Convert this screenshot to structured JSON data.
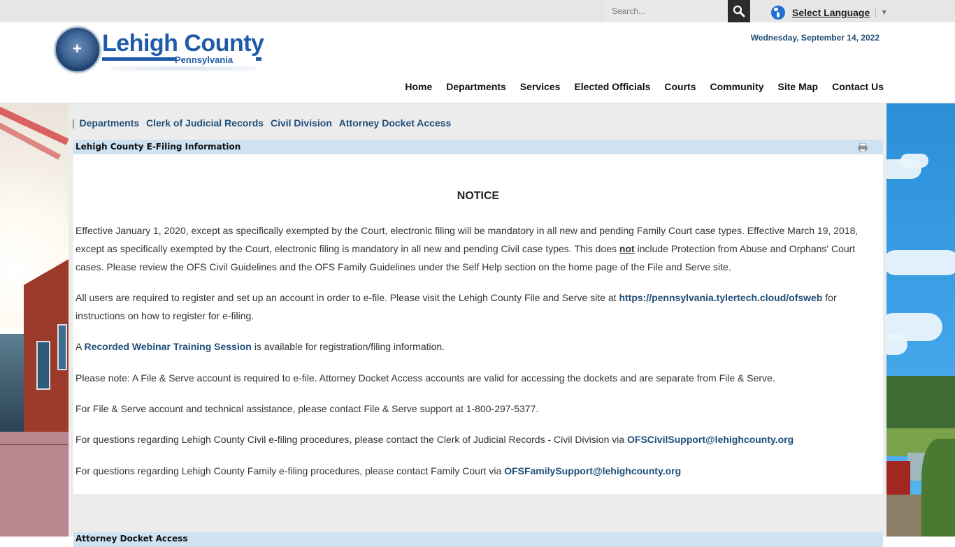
{
  "topbar": {
    "search_placeholder": "Search...",
    "search_button_icon": "search-icon",
    "language_icon": "globe-icon",
    "language_label": "Select Language",
    "language_arrow": "▼"
  },
  "header": {
    "logo_title": "Lehigh County",
    "logo_subtitle": "Pennsylvania",
    "date": "Wednesday, September 14, 2022",
    "nav": [
      {
        "label": "Home"
      },
      {
        "label": "Departments"
      },
      {
        "label": "Services"
      },
      {
        "label": "Elected Officials"
      },
      {
        "label": "Courts"
      },
      {
        "label": "Community"
      },
      {
        "label": "Site Map"
      },
      {
        "label": "Contact Us"
      }
    ]
  },
  "breadcrumb": {
    "separator": "|",
    "items": [
      {
        "label": "Departments"
      },
      {
        "label": "Clerk of Judicial Records"
      },
      {
        "label": "Civil Division"
      },
      {
        "label": "Attorney Docket Access"
      }
    ]
  },
  "panel": {
    "title": "Lehigh County E-Filing Information",
    "print_icon": "print-icon",
    "notice_heading": "NOTICE",
    "p1": {
      "a": "Effective January 1, 2020, except as specifically exempted by the Court, electronic filing will be mandatory in all new and pending Family Court case types.  Effective March 19, 2018, except as specifically exempted by the Court, electronic filing is mandatory in all new and pending Civil case types.  This does ",
      "emph": "not",
      "b": " include Protection from Abuse and Orphans' Court cases.  Please review the OFS Civil Guidelines and the OFS Family Guidelines under the Self Help section on the home page of the File and Serve site."
    },
    "p2": {
      "a": "All users are required to register and set up an account in order to e-file.  Please visit the Lehigh County File and Serve site at ",
      "link": "https://pennsylvania.tylertech.cloud/ofsweb",
      "b": " for instructions on how to register for e-filing."
    },
    "p3": {
      "a": "A ",
      "link": "Recorded Webinar Training Session",
      "b": " is available for registration/filing information."
    },
    "p4": "Please note:  A File & Serve  account is required to e-file.  Attorney Docket Access accounts are valid for accessing the dockets and are separate from File & Serve.",
    "p5": "For File & Serve account and technical assistance, please contact File & Serve support at 1-800-297-5377.",
    "p6": {
      "a": "For questions regarding Lehigh County Civil e-filing procedures, please contact the Clerk of Judicial Records - Civil Division via ",
      "link": "OFSCivilSupport@lehighcounty.org"
    },
    "p7": {
      "a": "For questions regarding Lehigh County Family e-filing procedures, please contact Family Court via ",
      "link": "OFSFamilySupport@lehighcounty.org"
    }
  },
  "panel2": {
    "title": "Attorney Docket Access"
  }
}
